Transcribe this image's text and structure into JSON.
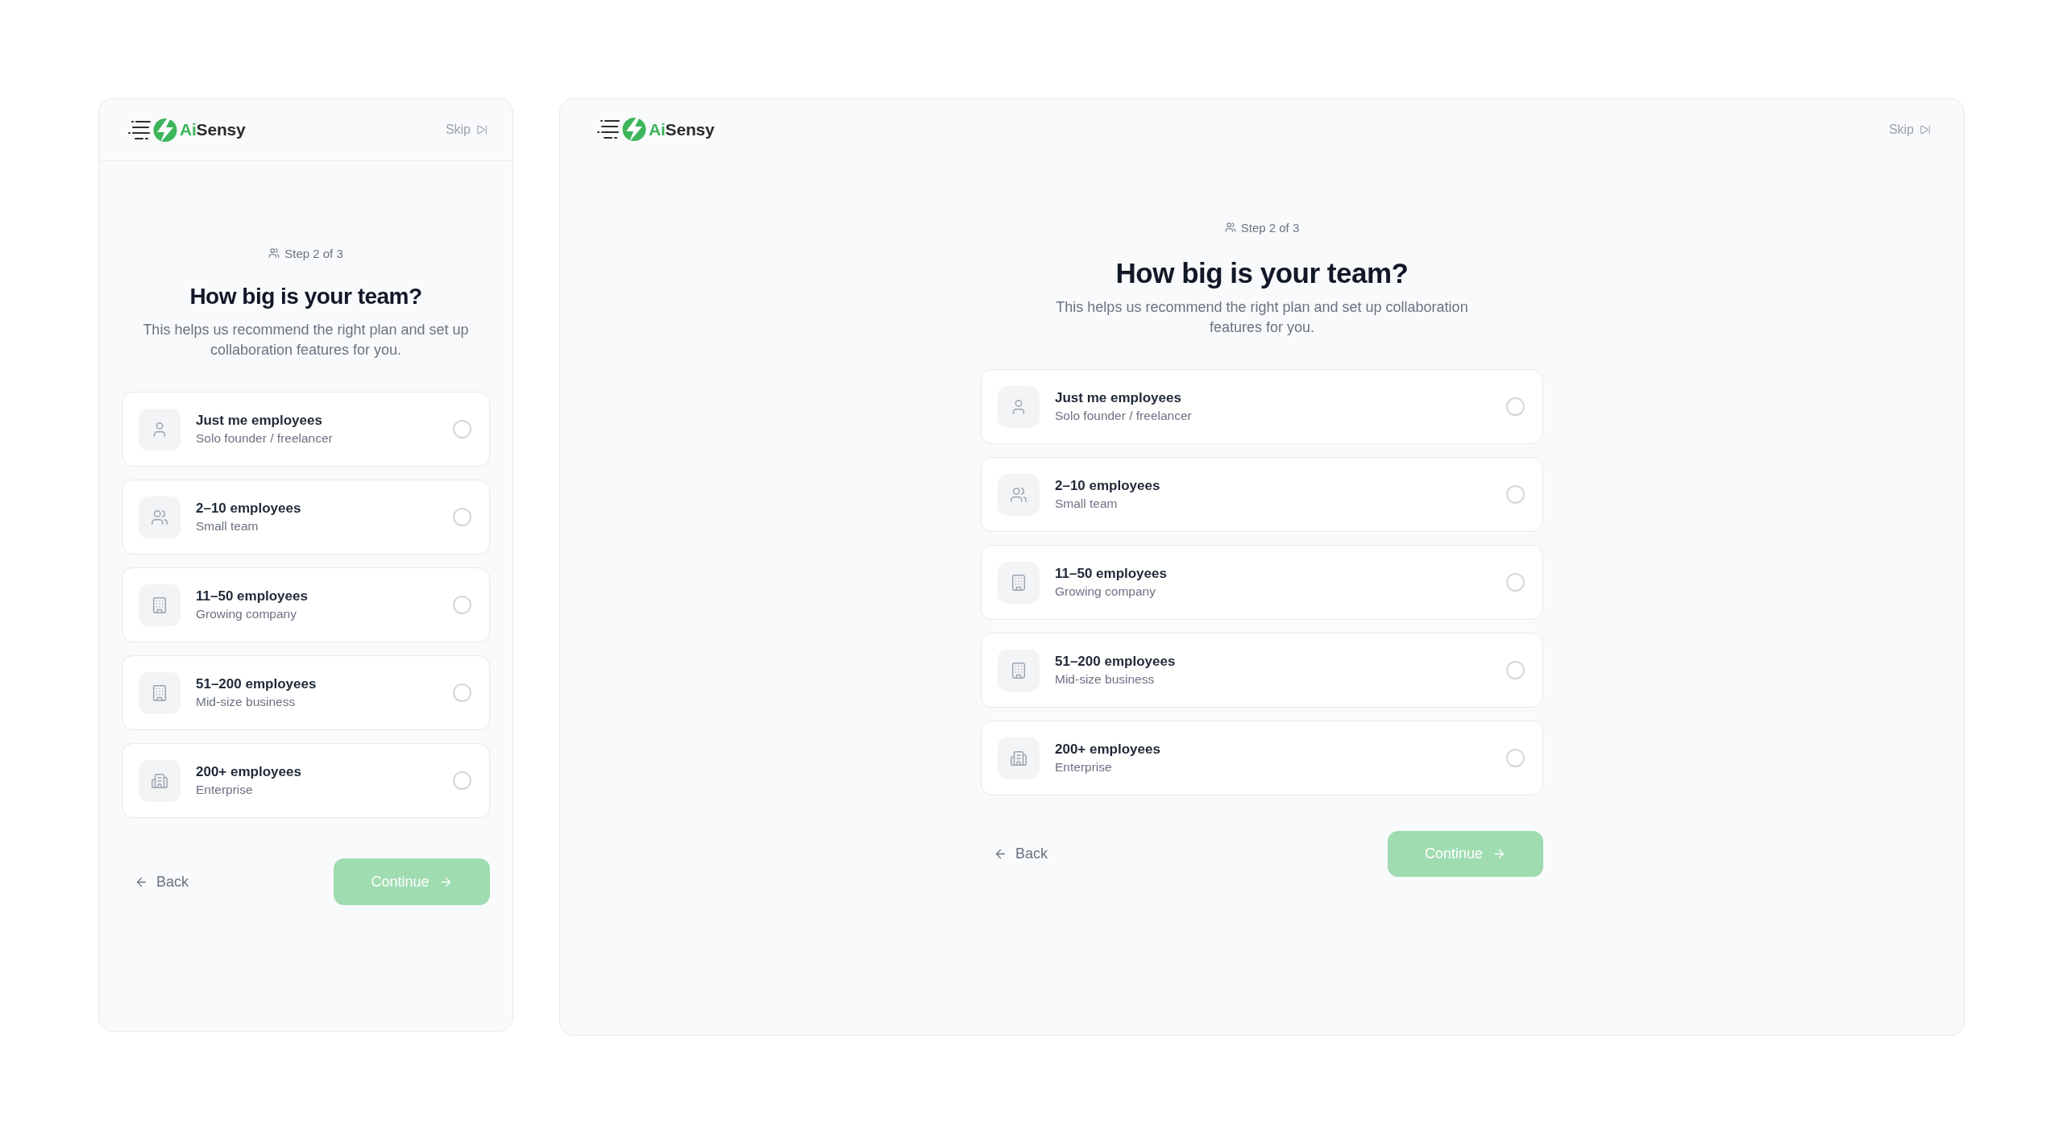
{
  "views": [
    {
      "kind": "mobile",
      "header": {
        "brand": {
          "accent": "Ai",
          "name": "Sensy"
        },
        "skip": "Skip"
      },
      "step": "Step 2 of 3",
      "title": "How big is your team?",
      "subtitle": "This helps us recommend the right plan and set up collaboration features for you.",
      "options": [
        {
          "title": "Just me employees",
          "note": "Solo founder / freelancer",
          "selected": false
        },
        {
          "title": "2–10 employees",
          "note": "Small team",
          "selected": false
        },
        {
          "title": "11–50 employees",
          "note": "Growing company",
          "selected": false
        },
        {
          "title": "51–200 employees",
          "note": "Mid-size business",
          "selected": false
        },
        {
          "title": "200+ employees",
          "note": "Enterprise",
          "selected": false
        }
      ],
      "back": "Back",
      "continue": {
        "label": "Continue",
        "disabled": true
      }
    },
    {
      "kind": "desktop",
      "header": {
        "brand": {
          "accent": "Ai",
          "name": "Sensy"
        },
        "skip": "Skip"
      },
      "step": "Step 2 of 3",
      "title": "How big is your team?",
      "subtitle": "This helps us recommend the right plan and set up collaboration features for you.",
      "options": [
        {
          "title": "Just me employees",
          "note": "Solo founder / freelancer",
          "selected": false
        },
        {
          "title": "2–10 employees",
          "note": "Small team",
          "selected": false
        },
        {
          "title": "11–50 employees",
          "note": "Growing company",
          "selected": false
        },
        {
          "title": "51–200 employees",
          "note": "Mid-size business",
          "selected": false
        },
        {
          "title": "200+ employees",
          "note": "Enterprise",
          "selected": false
        }
      ],
      "back": "Back",
      "continue": {
        "label": "Continue",
        "disabled": true
      }
    }
  ]
}
